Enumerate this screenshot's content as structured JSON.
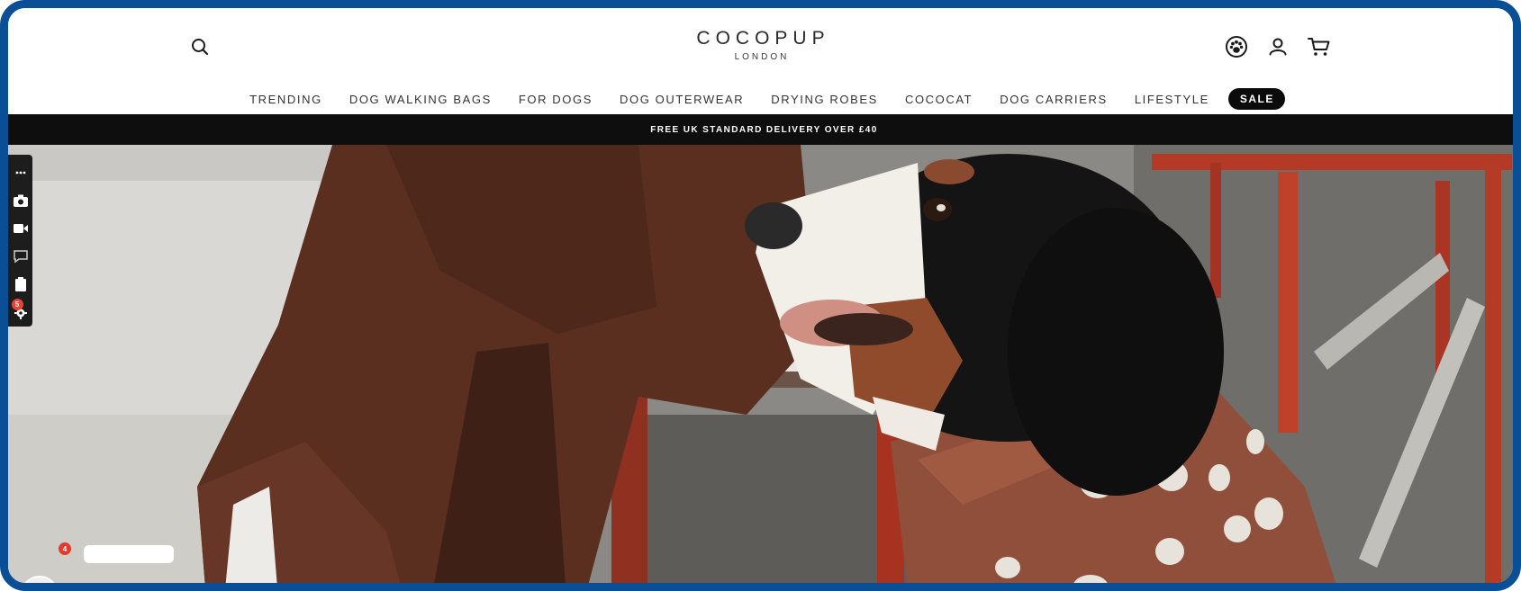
{
  "brand": {
    "name": "COCOPUP",
    "sub": "LONDON"
  },
  "header": {
    "icons": [
      "search-icon",
      "paw-icon",
      "account-icon",
      "cart-icon"
    ]
  },
  "nav": {
    "items": [
      {
        "label": "TRENDING"
      },
      {
        "label": "DOG WALKING BAGS"
      },
      {
        "label": "FOR DOGS"
      },
      {
        "label": "DOG OUTERWEAR"
      },
      {
        "label": "DRYING ROBES"
      },
      {
        "label": "COCOCAT"
      },
      {
        "label": "DOG CARRIERS"
      },
      {
        "label": "LIFESTYLE"
      }
    ],
    "sale_label": "SALE"
  },
  "announcement": {
    "text": "FREE UK STANDARD DELIVERY OVER £40"
  },
  "toolbar": {
    "badge_count": "5",
    "icons": [
      "more-icon",
      "camera-icon",
      "video-icon",
      "comment-icon",
      "clipboard-icon",
      "settings-icon"
    ]
  },
  "chat": {
    "badge_count": "4"
  },
  "colors": {
    "frame": "#0a4f96",
    "nav_text": "#333333",
    "sale_bg": "#0b0b0b",
    "announce_bg": "#0e0e0e",
    "badge": "#e8433a"
  }
}
